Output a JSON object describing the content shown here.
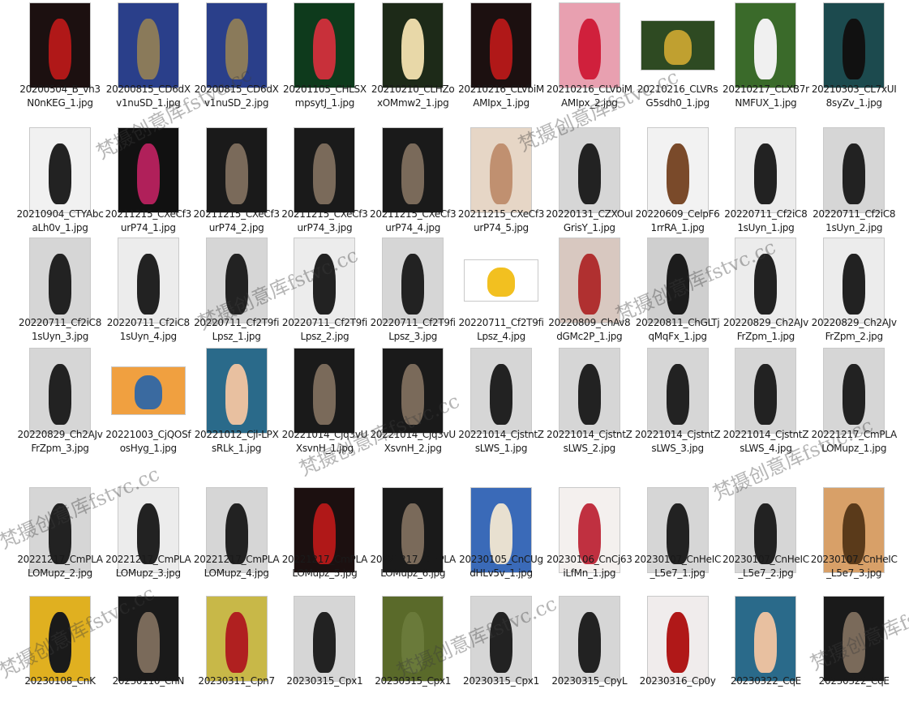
{
  "files": [
    {
      "name": "20200504_B_vh3N0nKEG_1.jpg",
      "thumb": "Rd"
    },
    {
      "name": "20200815_CD6dXv1nuSD_1.jpg",
      "thumb": "Bg"
    },
    {
      "name": "20200815_CD6dXv1nuSD_2.jpg",
      "thumb": "Bg"
    },
    {
      "name": "20201105_CHLSXmpsytJ_1.jpg",
      "thumb": "Gr"
    },
    {
      "name": "20210210_CLHZoxOMmw2_1.jpg",
      "thumb": "Cv"
    },
    {
      "name": "20210216_CLVbiMAMIpx_1.jpg",
      "thumb": "Rd"
    },
    {
      "name": "20210216_CLVbiMAMIpx_2.jpg",
      "thumb": "Pk"
    },
    {
      "name": "20210216_CLVRsG5sdh0_1.jpg",
      "thumb": "Gl"
    },
    {
      "name": "20210217_CLXB7rNMFUX_1.jpg",
      "thumb": "Gp"
    },
    {
      "name": "20210303_CL7xUI8syZv_1.jpg",
      "thumb": "Tl"
    },
    {
      "name": "20210904_CTYAbcaLh0v_1.jpg",
      "thumb": "Wh"
    },
    {
      "name": "20211215_CXeCf3urP74_1.jpg",
      "thumb": "Mg"
    },
    {
      "name": "20211215_CXeCf3urP74_2.jpg",
      "thumb": "Dk"
    },
    {
      "name": "20211215_CXeCf3urP74_3.jpg",
      "thumb": "Dk"
    },
    {
      "name": "20211215_CXeCf3urP74_4.jpg",
      "thumb": "Dk"
    },
    {
      "name": "20211215_CXeCf3urP74_5.jpg",
      "thumb": "Sk"
    },
    {
      "name": "20220131_CZXOuIGrisY_1.jpg",
      "thumb": "Gy"
    },
    {
      "name": "20220609_CelpF61rrRA_1.jpg",
      "thumb": "Vg"
    },
    {
      "name": "20220711_Cf2iC81sUyn_1.jpg",
      "thumb": "Lt"
    },
    {
      "name": "20220711_Cf2iC81sUyn_2.jpg",
      "thumb": "Gy"
    },
    {
      "name": "20220711_Cf2iC81sUyn_3.jpg",
      "thumb": "Gy"
    },
    {
      "name": "20220711_Cf2iC81sUyn_4.jpg",
      "thumb": "Lt"
    },
    {
      "name": "20220711_Cf2T9fiLpsz_1.jpg",
      "thumb": "Gy"
    },
    {
      "name": "20220711_Cf2T9fiLpsz_2.jpg",
      "thumb": "Lt"
    },
    {
      "name": "20220711_Cf2T9fiLpsz_3.jpg",
      "thumb": "Gy"
    },
    {
      "name": "20220711_Cf2T9fiLpsz_4.jpg",
      "thumb": "Yl"
    },
    {
      "name": "20220809_ChAv8dGMc2P_1.jpg",
      "thumb": "Mx"
    },
    {
      "name": "20220811_ChGLTjqMqFx_1.jpg",
      "thumb": "Bw"
    },
    {
      "name": "20220829_Ch2AJvFrZpm_1.jpg",
      "thumb": "Lt"
    },
    {
      "name": "20220829_Ch2AJvFrZpm_2.jpg",
      "thumb": "Lt"
    },
    {
      "name": "20220829_Ch2AJvFrZpm_3.jpg",
      "thumb": "Gy"
    },
    {
      "name": "20221003_CjQOSfosHyg_1.jpg",
      "thumb": "Sy"
    },
    {
      "name": "20221012_Cjl-LPXsRLk_1.jpg",
      "thumb": "Fc"
    },
    {
      "name": "20221014_Cjq3vUXsvnH_1.jpg",
      "thumb": "Dk"
    },
    {
      "name": "20221014_Cjq3vUXsvnH_2.jpg",
      "thumb": "Dk"
    },
    {
      "name": "20221014_CjstntZsLWS_1.jpg",
      "thumb": "Gy"
    },
    {
      "name": "20221014_CjstntZsLWS_2.jpg",
      "thumb": "Gy"
    },
    {
      "name": "20221014_CjstntZsLWS_3.jpg",
      "thumb": "Gy"
    },
    {
      "name": "20221014_CjstntZsLWS_4.jpg",
      "thumb": "Gy"
    },
    {
      "name": "20221217_CmPLALOMupz_1.jpg",
      "thumb": "Gy"
    },
    {
      "name": "20221217_CmPLALOMupz_2.jpg",
      "thumb": "Gy"
    },
    {
      "name": "20221217_CmPLALOMupz_3.jpg",
      "thumb": "Lt"
    },
    {
      "name": "20221217_CmPLALOMupz_4.jpg",
      "thumb": "Gy"
    },
    {
      "name": "20221217_CmPLALOMupz_5.jpg",
      "thumb": "Rd"
    },
    {
      "name": "20221217_CmPLALOMupz_6.jpg",
      "thumb": "Dk"
    },
    {
      "name": "20230105_CnCUgdHLv5v_1.jpg",
      "thumb": "Bv"
    },
    {
      "name": "20230106_CnCj63iLfMn_1.jpg",
      "thumb": "Pv"
    },
    {
      "name": "20230107_CnHeIC_L5e7_1.jpg",
      "thumb": "Gy"
    },
    {
      "name": "20230107_CnHeIC_L5e7_2.jpg",
      "thumb": "Gy"
    },
    {
      "name": "20230107_CnHeIC_L5e7_3.jpg",
      "thumb": "Wm"
    },
    {
      "name": "20230108_CnK",
      "thumb": "Ye"
    },
    {
      "name": "20230110_CnN",
      "thumb": "Dk"
    },
    {
      "name": "20230311_Cpn7",
      "thumb": "Gv"
    },
    {
      "name": "20230315_Cpx1",
      "thumb": "Gy"
    },
    {
      "name": "20230315_Cpx1",
      "thumb": "Ol"
    },
    {
      "name": "20230315_Cpx1",
      "thumb": "Gy"
    },
    {
      "name": "20230315_CpyL",
      "thumb": "Gy"
    },
    {
      "name": "20230316_Cp0y",
      "thumb": "Rw"
    },
    {
      "name": "20230322_CqE",
      "thumb": "Fc"
    },
    {
      "name": "20230322_CqE",
      "thumb": "Dk"
    }
  ],
  "watermarks": [
    "梵摄创意库fstvc.cc",
    "梵摄创意库fstvc.cc",
    "梵摄创意库fstvc.cc",
    "梵摄创意库fstvc.cc",
    "梵摄创意库fstvc.cc",
    "梵摄创意库fstvc.cc",
    "梵摄创意库fstvc.cc",
    "梵摄创意库fstvc.cc",
    "梵摄创意库fstvc.cc",
    "梵摄创意库fstvc.cc"
  ]
}
